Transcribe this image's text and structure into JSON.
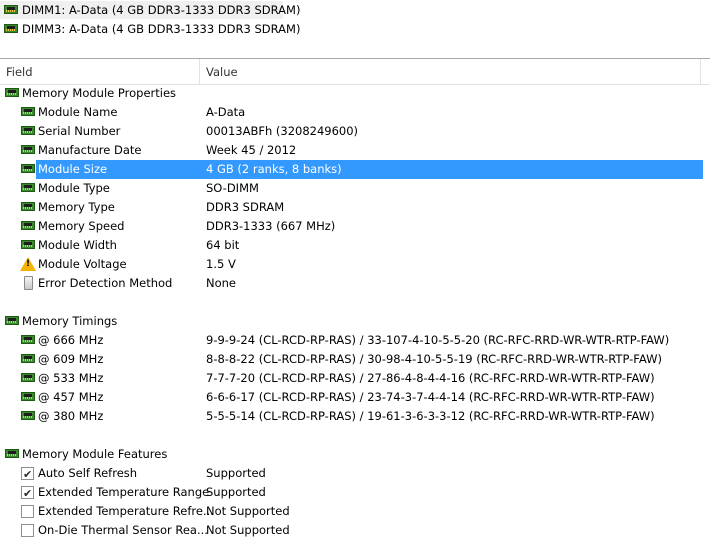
{
  "devices": [
    {
      "label": "DIMM1: A-Data (4 GB DDR3-1333 DDR3 SDRAM)",
      "selected": true
    },
    {
      "label": "DIMM3: A-Data (4 GB DDR3-1333 DDR3 SDRAM)",
      "selected": false
    }
  ],
  "columns": {
    "field": "Field",
    "value": "Value"
  },
  "sections": {
    "properties": {
      "title": "Memory Module Properties",
      "rows": [
        {
          "field": "Module Name",
          "value": "A-Data",
          "icon": "ram-icon"
        },
        {
          "field": "Serial Number",
          "value": "00013ABFh (3208249600)",
          "icon": "ram-icon"
        },
        {
          "field": "Manufacture Date",
          "value": "Week 45 / 2012",
          "icon": "ram-icon"
        },
        {
          "field": "Module Size",
          "value": "4 GB (2 ranks, 8 banks)",
          "icon": "ram-icon",
          "selected": true
        },
        {
          "field": "Module Type",
          "value": "SO-DIMM",
          "icon": "ram-icon"
        },
        {
          "field": "Memory Type",
          "value": "DDR3 SDRAM",
          "icon": "ram-icon"
        },
        {
          "field": "Memory Speed",
          "value": "DDR3-1333 (667 MHz)",
          "icon": "ram-icon"
        },
        {
          "field": "Module Width",
          "value": "64 bit",
          "icon": "ram-icon"
        },
        {
          "field": "Module Voltage",
          "value": "1.5 V",
          "icon": "warning-icon"
        },
        {
          "field": "Error Detection Method",
          "value": "None",
          "icon": "device-icon"
        }
      ]
    },
    "timings": {
      "title": "Memory Timings",
      "rows": [
        {
          "field": "@ 666 MHz",
          "value": "9-9-9-24  (CL-RCD-RP-RAS) / 33-107-4-10-5-5-20  (RC-RFC-RRD-WR-WTR-RTP-FAW)"
        },
        {
          "field": "@ 609 MHz",
          "value": "8-8-8-22  (CL-RCD-RP-RAS) / 30-98-4-10-5-5-19  (RC-RFC-RRD-WR-WTR-RTP-FAW)"
        },
        {
          "field": "@ 533 MHz",
          "value": "7-7-7-20  (CL-RCD-RP-RAS) / 27-86-4-8-4-4-16  (RC-RFC-RRD-WR-WTR-RTP-FAW)"
        },
        {
          "field": "@ 457 MHz",
          "value": "6-6-6-17  (CL-RCD-RP-RAS) / 23-74-3-7-4-4-14  (RC-RFC-RRD-WR-WTR-RTP-FAW)"
        },
        {
          "field": "@ 380 MHz",
          "value": "5-5-5-14  (CL-RCD-RP-RAS) / 19-61-3-6-3-3-12  (RC-RFC-RRD-WR-WTR-RTP-FAW)"
        }
      ]
    },
    "features": {
      "title": "Memory Module Features",
      "rows": [
        {
          "field": "Auto Self Refresh",
          "value": "Supported",
          "checked": true
        },
        {
          "field": "Extended Temperature Range",
          "value": "Supported",
          "checked": true
        },
        {
          "field": "Extended Temperature Refre...",
          "value": "Not Supported",
          "checked": false
        },
        {
          "field": "On-Die Thermal Sensor Rea...",
          "value": "Not Supported",
          "checked": false
        }
      ]
    }
  }
}
